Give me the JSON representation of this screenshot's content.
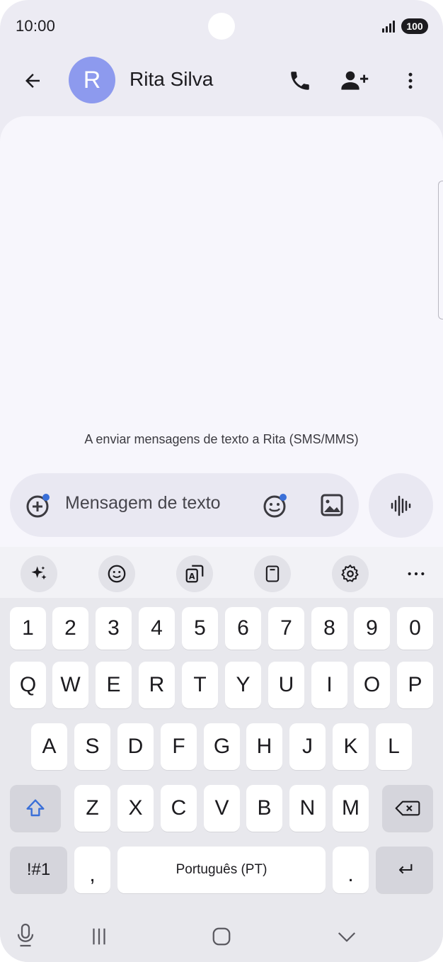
{
  "status_bar": {
    "time": "10:00",
    "battery": "100",
    "signal_icon": "signal-bars-icon"
  },
  "header": {
    "back_icon": "arrow-back-icon",
    "avatar_letter": "R",
    "avatar_color": "#8d9aee",
    "contact_name": "Rita Silva",
    "call_icon": "phone-icon",
    "add_contact_icon": "add-person-icon",
    "more_icon": "more-vert-icon"
  },
  "conversation": {
    "note": "A enviar mensagens de texto a Rita (SMS/MMS)"
  },
  "composer": {
    "add_icon": "add-circle-icon",
    "placeholder": "Mensagem de texto",
    "emoji_icon": "emoji-icon",
    "image_icon": "image-icon",
    "voice_icon": "voice-waveform-icon"
  },
  "keyboard": {
    "toolbar": [
      "sparkle-icon",
      "emoji-icon",
      "translate-icon",
      "clipboard-icon",
      "settings-icon",
      "more-horiz-icon"
    ],
    "row_numbers": [
      "1",
      "2",
      "3",
      "4",
      "5",
      "6",
      "7",
      "8",
      "9",
      "0"
    ],
    "row_1": [
      "Q",
      "W",
      "E",
      "R",
      "T",
      "Y",
      "U",
      "I",
      "O",
      "P"
    ],
    "row_2": [
      "A",
      "S",
      "D",
      "F",
      "G",
      "H",
      "J",
      "K",
      "L"
    ],
    "row_3": [
      "Z",
      "X",
      "C",
      "V",
      "B",
      "N",
      "M"
    ],
    "symbols_key": "!#1",
    "comma_key": ",",
    "space_label": "Português (PT)",
    "period_key": ".",
    "accent_color": "#3a6fd8"
  },
  "nav_bar": {
    "mic_icon": "mic-icon",
    "recents_icon": "recents-icon",
    "home_icon": "home-icon",
    "hide_keyboard_icon": "chevron-down-icon"
  }
}
